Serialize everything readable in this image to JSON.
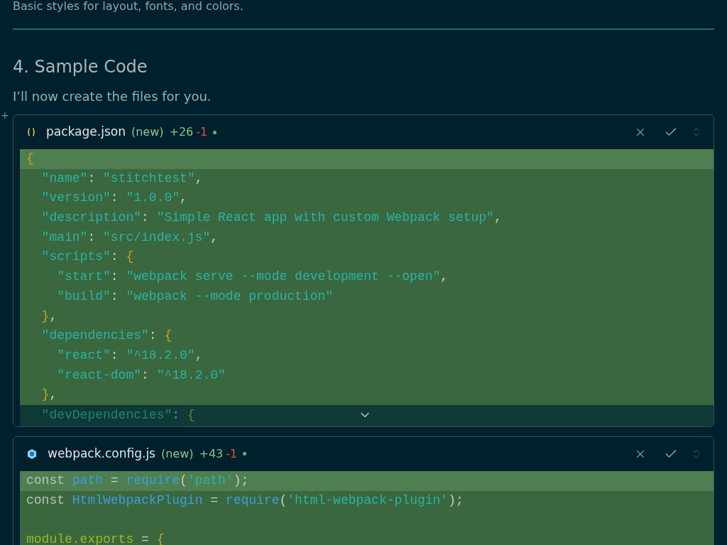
{
  "intro": "Basic styles for layout, fonts, and colors.",
  "heading": "4. Sample Code",
  "cursor_mark": "+",
  "paragraph": "I’ll now create the files for you.",
  "files": [
    {
      "kind": "json",
      "name": "package.json",
      "status": "(new)",
      "added": "+26",
      "removed": "-1",
      "collapsed": true,
      "lines": [
        {
          "highlighted": true,
          "tokens": [
            {
              "kind": "brace",
              "text": "{"
            }
          ]
        },
        {
          "highlighted": false,
          "tokens": [
            {
              "kind": "str",
              "text": "  \"name\""
            },
            {
              "kind": "punc",
              "text": ": "
            },
            {
              "kind": "str",
              "text": "\"stitchtest\""
            },
            {
              "kind": "punc",
              "text": ","
            }
          ]
        },
        {
          "highlighted": false,
          "tokens": [
            {
              "kind": "str",
              "text": "  \"version\""
            },
            {
              "kind": "punc",
              "text": ": "
            },
            {
              "kind": "str",
              "text": "\"1.0.0\""
            },
            {
              "kind": "punc",
              "text": ","
            }
          ]
        },
        {
          "highlighted": false,
          "tokens": [
            {
              "kind": "str",
              "text": "  \"description\""
            },
            {
              "kind": "punc",
              "text": ": "
            },
            {
              "kind": "str",
              "text": "\"Simple React app with custom Webpack setup\""
            },
            {
              "kind": "punc",
              "text": ","
            }
          ]
        },
        {
          "highlighted": false,
          "tokens": [
            {
              "kind": "str",
              "text": "  \"main\""
            },
            {
              "kind": "punc",
              "text": ": "
            },
            {
              "kind": "str",
              "text": "\"src/index.js\""
            },
            {
              "kind": "punc",
              "text": ","
            }
          ]
        },
        {
          "highlighted": false,
          "tokens": [
            {
              "kind": "str",
              "text": "  \"scripts\""
            },
            {
              "kind": "punc",
              "text": ": "
            },
            {
              "kind": "brace",
              "text": "{"
            }
          ]
        },
        {
          "highlighted": false,
          "tokens": [
            {
              "kind": "str",
              "text": "    \"start\""
            },
            {
              "kind": "punc",
              "text": ": "
            },
            {
              "kind": "str",
              "text": "\"webpack serve --mode development --open\""
            },
            {
              "kind": "punc",
              "text": ","
            }
          ]
        },
        {
          "highlighted": false,
          "tokens": [
            {
              "kind": "str",
              "text": "    \"build\""
            },
            {
              "kind": "punc",
              "text": ": "
            },
            {
              "kind": "str",
              "text": "\"webpack --mode production\""
            }
          ]
        },
        {
          "highlighted": false,
          "tokens": [
            {
              "kind": "brace",
              "text": "  }"
            },
            {
              "kind": "punc",
              "text": ","
            }
          ]
        },
        {
          "highlighted": false,
          "tokens": [
            {
              "kind": "str",
              "text": "  \"dependencies\""
            },
            {
              "kind": "punc",
              "text": ": "
            },
            {
              "kind": "brace",
              "text": "{"
            }
          ]
        },
        {
          "highlighted": false,
          "tokens": [
            {
              "kind": "str",
              "text": "    \"react\""
            },
            {
              "kind": "punc",
              "text": ": "
            },
            {
              "kind": "str",
              "text": "\"^18.2.0\""
            },
            {
              "kind": "punc",
              "text": ","
            }
          ]
        },
        {
          "highlighted": false,
          "tokens": [
            {
              "kind": "str",
              "text": "    \"react-dom\""
            },
            {
              "kind": "punc",
              "text": ": "
            },
            {
              "kind": "str",
              "text": "\"^18.2.0\""
            }
          ]
        },
        {
          "highlighted": false,
          "tokens": [
            {
              "kind": "brace",
              "text": "  }"
            },
            {
              "kind": "punc",
              "text": ","
            }
          ]
        },
        {
          "highlighted": false,
          "tokens": [
            {
              "kind": "str",
              "text": "  \"devDependencies\""
            },
            {
              "kind": "punc",
              "text": ": "
            },
            {
              "kind": "brace",
              "text": "{"
            }
          ]
        }
      ]
    },
    {
      "kind": "js",
      "name": "webpack.config.js",
      "status": "(new)",
      "added": "+43",
      "removed": "-1",
      "collapsed": false,
      "lines": [
        {
          "highlighted": true,
          "tokens": [
            {
              "kind": "kw",
              "text": "const "
            },
            {
              "kind": "ident",
              "text": "path"
            },
            {
              "kind": "punc",
              "text": " = "
            },
            {
              "kind": "ident",
              "text": "require"
            },
            {
              "kind": "punc",
              "text": "("
            },
            {
              "kind": "str",
              "text": "'path'"
            },
            {
              "kind": "punc",
              "text": ");"
            }
          ]
        },
        {
          "highlighted": false,
          "tokens": [
            {
              "kind": "kw",
              "text": "const "
            },
            {
              "kind": "ident",
              "text": "HtmlWebpackPlugin"
            },
            {
              "kind": "punc",
              "text": " = "
            },
            {
              "kind": "ident",
              "text": "require"
            },
            {
              "kind": "punc",
              "text": "("
            },
            {
              "kind": "str",
              "text": "'html-webpack-plugin'"
            },
            {
              "kind": "punc",
              "text": ");"
            }
          ]
        },
        {
          "highlighted": false
        },
        {
          "highlighted": false,
          "tokens": [
            {
              "kind": "obj",
              "text": "module.exports"
            },
            {
              "kind": "punc",
              "text": " = "
            },
            {
              "kind": "brace",
              "text": "{"
            }
          ]
        }
      ]
    }
  ]
}
